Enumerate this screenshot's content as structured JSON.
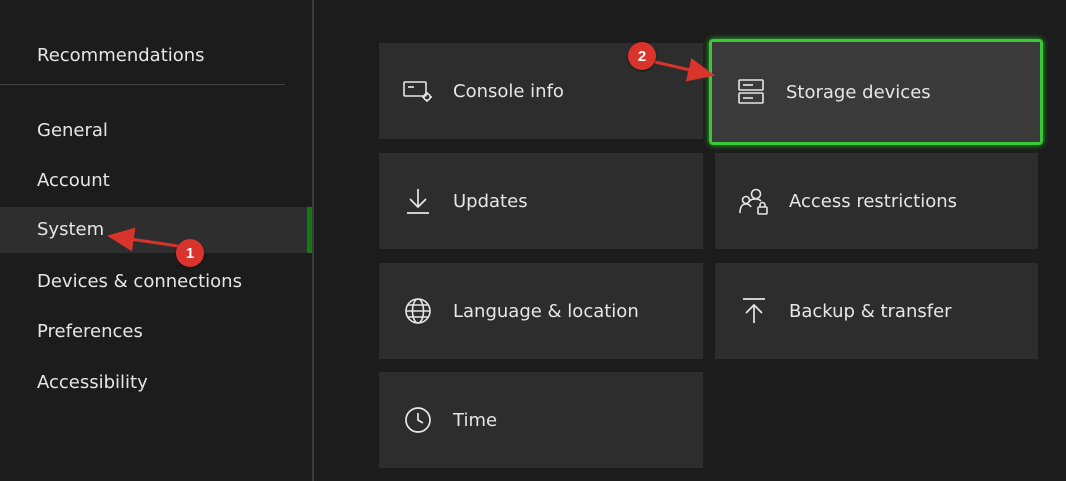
{
  "sidebar": {
    "header": "Recommendations",
    "items": [
      {
        "label": "General"
      },
      {
        "label": "Account"
      },
      {
        "label": "System"
      },
      {
        "label": "Devices & connections"
      },
      {
        "label": "Preferences"
      },
      {
        "label": "Accessibility"
      }
    ],
    "active_item": "System"
  },
  "tiles": [
    {
      "label": "Console info",
      "icon": "console-info-icon"
    },
    {
      "label": "Storage devices",
      "icon": "storage-icon",
      "focused": true
    },
    {
      "label": "Updates",
      "icon": "download-icon"
    },
    {
      "label": "Access restrictions",
      "icon": "people-lock-icon"
    },
    {
      "label": "Language & location",
      "icon": "globe-icon"
    },
    {
      "label": "Backup & transfer",
      "icon": "upload-icon"
    },
    {
      "label": "Time",
      "icon": "clock-icon"
    }
  ],
  "annotations": [
    {
      "number": "1"
    },
    {
      "number": "2"
    }
  ],
  "colors": {
    "background": "#1c1c1c",
    "tile": "#2d2d2d",
    "focus": "#38c838",
    "accent": "#107c10",
    "badge": "#d9342b"
  }
}
